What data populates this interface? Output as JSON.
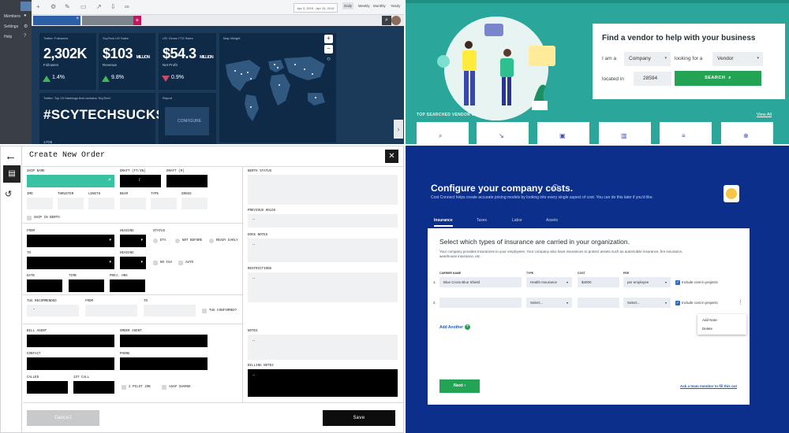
{
  "dashboard": {
    "sidebar": [
      "Members",
      "Settings",
      "Help"
    ],
    "date_range": "Apr 3, 2019 - Apr 15, 2019",
    "periods": [
      "Daily",
      "Weekly",
      "Monthly",
      "Yearly"
    ],
    "cards": [
      {
        "label": "Twitter: Followers",
        "value": "2,302K",
        "sub": "Followers",
        "pct": "1.4%",
        "trend": "up"
      },
      {
        "label": "ScyTech US Sales",
        "value": "$103",
        "unit": "MILLION",
        "sub": "Revenue",
        "pct": "9.8%",
        "trend": "up"
      },
      {
        "label": "US: Gross YTD Sales",
        "value": "$54.3",
        "unit": "MILLION",
        "sub": "Net Profit",
        "pct": "0.9%",
        "trend": "down"
      }
    ],
    "map_label": "Map Widget",
    "hashtag_label": "Twitter: Top 10 Hashtags that contains 'ScyTech'",
    "hashtag": "#SCYTECHSUCKS",
    "hashtag_date": "17/05",
    "report_label": "Report",
    "configure": "CONFIGURE"
  },
  "vendor": {
    "heading": "Find a vendor to help with your business",
    "i_am_a": "I am a",
    "looking_for": "looking for a",
    "located_in": "located in",
    "company": "Company",
    "vendor": "Vendor",
    "zip": "28594",
    "search": "SEARCH",
    "top_categories": "TOP SEARCHED VENDOR CATEGORIES",
    "view_all": "View All"
  },
  "order": {
    "title": "Create New Order",
    "labels": {
      "ship_name": "SHIP NAME",
      "draft_ft": "DRAFT (FT/IN)",
      "draft_m": "DRAFT (M)",
      "imo": "IMO",
      "thruster": "THRUSTER",
      "length": "LENGTH",
      "beam": "BEAM",
      "type": "TYPE",
      "gross": "GROSS",
      "ship_in_berth": "SHIP IN BERTH",
      "from": "FROM",
      "heading": "HEADING",
      "status": "STATUS",
      "eta": "ETA",
      "not_before": "NOT BEFORE",
      "ready_early": "READY EARLY",
      "to": "TO",
      "heading2": "HEADING",
      "in_isa": "NO ISA",
      "auto": "AUTO",
      "date": "DATE",
      "time": "TIME",
      "prev_hrs": "PROJ. HRS",
      "tug_recommended": "TUG RECOMMENDED",
      "from2": "FROM",
      "to2": "TO",
      "tug_confirmed": "TUG CONFIRMED?",
      "bill_agent": "BILL AGENT",
      "order_agent": "ORDER AGENT",
      "contact": "CONTACT",
      "phone": "PHONE",
      "called": "CALLED",
      "first_call": "1ST CALL",
      "two_pilot": "2 PILOT JOB",
      "asap": "ASAP CHARGE",
      "berth_status": "BERTH STATUS",
      "previous_holds": "PREVIOUS HOLDS",
      "dock_notes": "DOCK NOTES",
      "restrictions": "RESTRICTIONS",
      "notes": "NOTES",
      "billing_notes": "BILLING NOTES"
    },
    "draft_sep": "/",
    "tug_value": "-",
    "cancel": "Cancel",
    "save": "Save"
  },
  "costs": {
    "title": "Configure your company costs.",
    "subtitle": "Cost Connect helps create accurate pricing models by looking into every single aspect of cost. You can do this later if you'd like.",
    "tabs": [
      "Insurance",
      "Taxes",
      "Labor",
      "Assets"
    ],
    "panel_title": "Select which types of insurance are carried in your organization.",
    "panel_desc": "Your company provides insurances to your employees. Your company also have insurances to protect assets such as automobile insurance, fire insurance, warehouse insurance, etc.",
    "columns": [
      "CARRIER NAME",
      "TYPE",
      "COST",
      "PER"
    ],
    "rows": [
      {
        "num": "1.",
        "carrier": "Blue Cross Blue Shield",
        "type": "Health Insurance",
        "cost": "$4000",
        "per": "per employee",
        "include": "Include cost in projects"
      },
      {
        "num": "2.",
        "carrier": "",
        "type": "Select...",
        "cost": "",
        "per": "Select...",
        "include": "Include cost in projects"
      }
    ],
    "menu": [
      "Add Note",
      "Delete"
    ],
    "add_another": "Add Another",
    "next": "Next",
    "ask": "Ask a team member to fill this out"
  }
}
